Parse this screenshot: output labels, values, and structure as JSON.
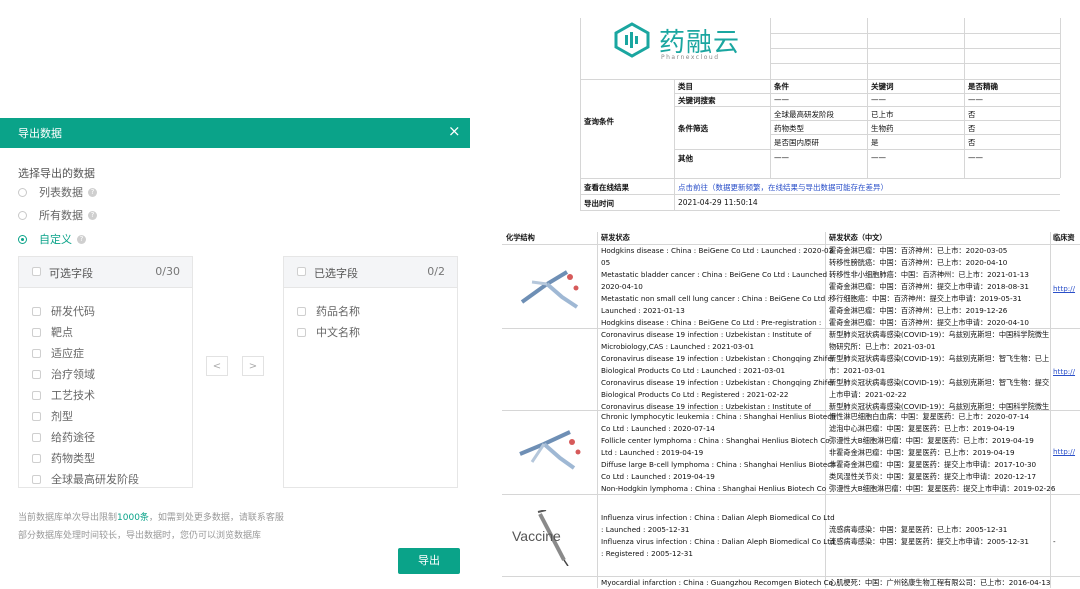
{
  "dialog": {
    "title": "导出数据",
    "close_icon": "×",
    "section_label": "选择导出的数据",
    "radio_options": [
      "列表数据",
      "所有数据",
      "自定义"
    ],
    "selected_option": "自定义",
    "available": {
      "title": "可选字段",
      "count": "0/30",
      "items": [
        "研发代码",
        "靶点",
        "适应症",
        "治疗领域",
        "工艺技术",
        "剂型",
        "给药途径",
        "药物类型",
        "全球最高研发阶段"
      ]
    },
    "selected": {
      "title": "已选字段",
      "count": "0/2",
      "items": [
        "药品名称",
        "中文名称"
      ]
    },
    "nav_left": "<",
    "nav_right": ">",
    "note_line1_pre": "当前数据库单次导出限制",
    "note_line1_hl": "1000条",
    "note_line1_post": "，如需到处更多数据，请联系客服",
    "note_line2": "部分数据库处理时间较长，导出数据时，您仍可以浏览数据库",
    "export_label": "导出",
    "accent_color": "#0aa389"
  },
  "sheet_top": {
    "logo_text": "药融云",
    "logo_sub": "Pharnexcloud",
    "headers": [
      "类目",
      "条件",
      "关键词",
      "是否精确"
    ],
    "query_label": "查询条件",
    "rows": [
      [
        "关键词搜索",
        "——",
        "——",
        "——"
      ],
      [
        "",
        "全球最高研发阶段",
        "已上市",
        "否"
      ],
      [
        "条件筛选",
        "药物类型",
        "生物药",
        "否"
      ],
      [
        "",
        "是否国内原研",
        "是",
        "否"
      ],
      [
        "其他",
        "——",
        "——",
        "——"
      ]
    ],
    "online_result_label": "查看在线结果",
    "online_result_link": "点击前往（数据更新频繁，在线结果与导出数据可能存在差异）",
    "export_time_label": "导出时间",
    "export_time_value": "2021-04-29 11:50:14"
  },
  "sheet_bottom": {
    "headers": [
      "化学结构",
      "研发状态",
      "研发状态（中文）",
      "临床资"
    ],
    "vaccine_label": "Vaccine",
    "url_text": "http://",
    "groups": [
      {
        "en": [
          "Hodgkins disease : China : BeiGene Co Ltd : Launched : 2020-03-",
          "05",
          "Metastatic bladder cancer : China : BeiGene Co Ltd : Launched :",
          "2020-04-10",
          "Metastatic non small cell lung cancer : China : BeiGene Co Ltd :",
          "Launched : 2021-01-13",
          "Hodgkins disease : China : BeiGene Co Ltd : Pre-registration :"
        ],
        "cn": [
          "霍奇金淋巴瘤：中国：百济神州：已上市：2020-03-05",
          "转移性膀胱癌：中国：百济神州：已上市：2020-04-10",
          "转移性非小细胞肺癌：中国：百济神州：已上市：2021-01-13",
          "霍奇金淋巴瘤：中国：百济神州：提交上市申请：2018-08-31",
          "移行细胞癌：中国：百济神州：提交上市申请：2019-05-31",
          "霍奇金淋巴瘤：中国：百济神州：已上市：2019-12-26",
          "霍奇金淋巴瘤：中国：百济神州：提交上市申请：2020-04-10"
        ],
        "has_url": true
      },
      {
        "en": [
          "Coronavirus disease 19 infection : Uzbekistan : Institute of",
          "Microbiology,CAS : Launched : 2021-03-01",
          "Coronavirus disease 19 infection : Uzbekistan : Chongqing Zhifei",
          "Biological Products Co Ltd : Launched : 2021-03-01",
          "Coronavirus disease 19 infection : Uzbekistan : Chongqing Zhifei",
          "Biological Products Co Ltd : Registered : 2021-02-22",
          "Coronavirus disease 19 infection : Uzbekistan : Institute of"
        ],
        "cn": [
          "新型肺炎冠状病毒感染(COVID-19)：乌兹别克斯坦：中国科学院微生",
          "物研究所：已上市：2021-03-01",
          "新型肺炎冠状病毒感染(COVID-19)：乌兹别克斯坦：智飞生物：已上",
          "市：2021-03-01",
          "新型肺炎冠状病毒感染(COVID-19)：乌兹别克斯坦：智飞生物：提交",
          "上市申请：2021-02-22",
          "新型肺炎冠状病毒感染(COVID-19)：乌兹别克斯坦：中国科学院微生"
        ],
        "has_url": true
      },
      {
        "en": [
          "Chronic lymphocytic leukemia : China : Shanghai Henlius Biotech",
          "Co Ltd : Launched : 2020-07-14",
          "Follicle center lymphoma : China : Shanghai Henlius Biotech Co",
          "Ltd : Launched : 2019-04-19",
          "Diffuse large B-cell lymphoma : China : Shanghai Henlius Biotech",
          "Co Ltd : Launched : 2019-04-19",
          "Non-Hodgkin lymphoma : China : Shanghai Henlius Biotech Co"
        ],
        "cn": [
          "慢性淋巴细胞白血病：中国：复星医药：已上市：2020-07-14",
          "滤泡中心淋巴瘤：中国：复星医药：已上市：2019-04-19",
          "弥漫性大B细胞淋巴瘤：中国：复星医药：已上市：2019-04-19",
          "非霍奇金淋巴瘤：中国：复星医药：已上市：2019-04-19",
          "非霍奇金淋巴瘤：中国：复星医药：提交上市申请：2017-10-30",
          "类风湿性关节炎：中国：复星医药：提交上市申请：2020-12-17",
          "弥漫性大B细胞淋巴瘤：中国：复星医药：提交上市申请：2019-02-26"
        ],
        "has_url": true
      },
      {
        "en": [
          "Influenza virus infection : China : Dalian Aleph Biomedical Co Ltd",
          ": Launched : 2005-12-31",
          "Influenza virus infection : China : Dalian Aleph Biomedical Co Ltd",
          ": Registered : 2005-12-31"
        ],
        "cn": [
          "流感病毒感染：中国：复星医药：已上市：2005-12-31",
          "流感病毒感染：中国：复星医药：提交上市申请：2005-12-31"
        ],
        "has_url": false,
        "dash": "-"
      },
      {
        "en": [
          "Myocardial infarction : China : Guangzhou Recomgen Biotech Co"
        ],
        "cn": [
          "心肌梗死：中国：广州铭康生物工程有限公司：已上市：2016-04-13"
        ],
        "has_url": false
      }
    ]
  }
}
